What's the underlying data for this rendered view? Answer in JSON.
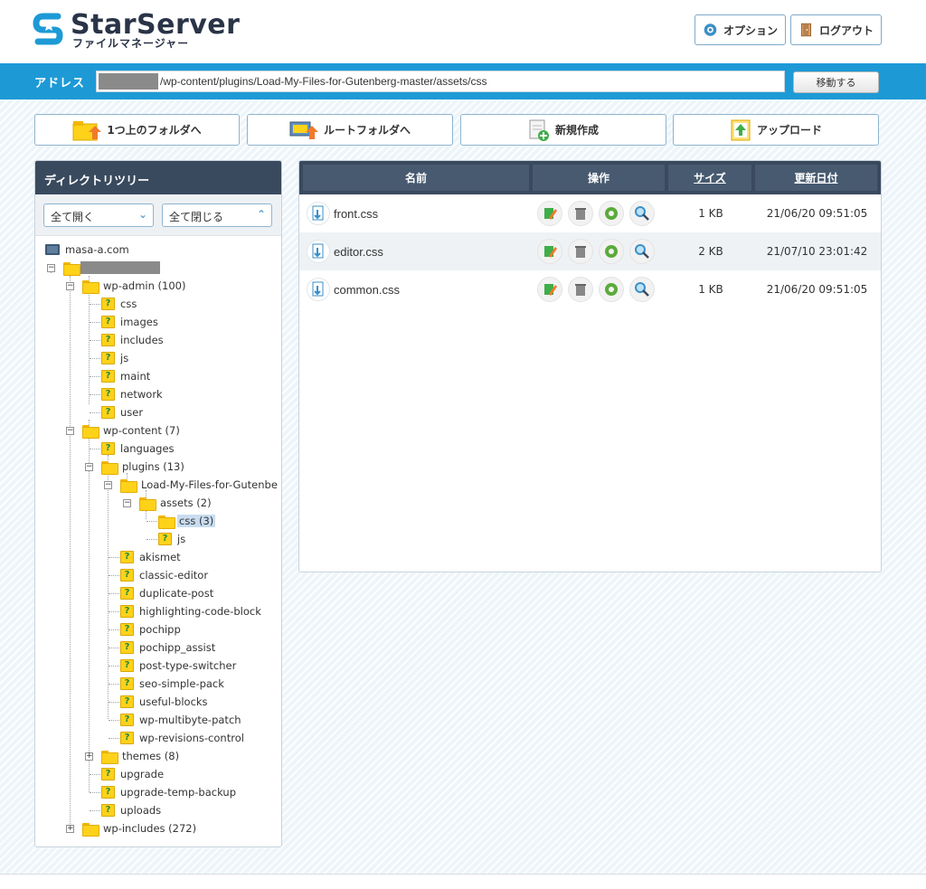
{
  "app": {
    "logo_title": "StarServer",
    "logo_subtitle": "ファイルマネージャー",
    "options_label": "オプション",
    "logout_label": "ログアウト"
  },
  "address": {
    "label": "アドレス",
    "value": "/wp-content/plugins/Load-My-Files-for-Gutenberg-master/assets/css",
    "go_label": "移動する"
  },
  "actions": {
    "up_label": "1つ上のフォルダへ",
    "root_label": "ルートフォルダへ",
    "new_label": "新規作成",
    "upload_label": "アップロード"
  },
  "tree": {
    "title": "ディレクトリツリー",
    "open_all": "全て開く",
    "close_all": "全て閉じる",
    "host": "masa-a.com",
    "wp_admin": "wp-admin (100)",
    "wp_admin_children": [
      "css",
      "images",
      "includes",
      "js",
      "maint",
      "network",
      "user"
    ],
    "wp_content": "wp-content (7)",
    "languages": "languages",
    "plugins": "plugins (13)",
    "load_my_files": "Load-My-Files-for-Gutenbe",
    "assets": "assets (2)",
    "css_selected": "css (3)",
    "js": "js",
    "plugin_list": [
      "akismet",
      "classic-editor",
      "duplicate-post",
      "highlighting-code-block",
      "pochipp",
      "pochipp_assist",
      "post-type-switcher",
      "seo-simple-pack",
      "useful-blocks",
      "wp-multibyte-patch",
      "wp-revisions-control"
    ],
    "themes": "themes (8)",
    "upgrade": "upgrade",
    "upgrade_temp": "upgrade-temp-backup",
    "uploads": "uploads",
    "wp_includes": "wp-includes (272)"
  },
  "files": {
    "headers": {
      "name": "名前",
      "ops": "操作",
      "size": "サイズ",
      "date": "更新日付"
    },
    "rows": [
      {
        "name": "front.css",
        "size": "1 KB",
        "date": "21/06/20 09:51:05"
      },
      {
        "name": "editor.css",
        "size": "2 KB",
        "date": "21/07/10 23:01:42"
      },
      {
        "name": "common.css",
        "size": "1 KB",
        "date": "21/06/20 09:51:05"
      }
    ]
  },
  "colors": {
    "accent_blue": "#1d9ad6",
    "header_dark": "#3a4a5e",
    "folder_yellow": "#ffd21a"
  }
}
